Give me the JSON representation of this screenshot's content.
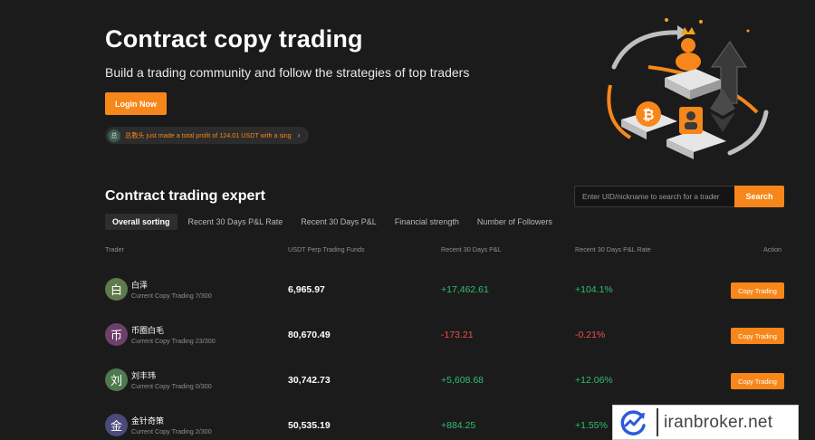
{
  "hero": {
    "title": "Contract copy trading",
    "subtitle": "Build a trading community and follow the strategies of top traders",
    "login_label": "Login Now",
    "notice": {
      "avatar_char": "总",
      "text": "总教头 just made a total profit of 124.01 USDT with a sing"
    }
  },
  "section": {
    "title": "Contract trading expert",
    "search_placeholder": "Enter UID/nickname to search for a trader",
    "search_label": "Search"
  },
  "tabs": [
    {
      "label": "Overall sorting",
      "active": true
    },
    {
      "label": "Recent 30 Days P&L Rate",
      "active": false
    },
    {
      "label": "Recent 30 Days P&L",
      "active": false
    },
    {
      "label": "Financial strength",
      "active": false
    },
    {
      "label": "Number of Followers",
      "active": false
    }
  ],
  "table": {
    "headers": {
      "trader": "Trader",
      "funds": "USDT Perp Trading Funds",
      "pnl": "Recent 30 Days P&L",
      "rate": "Recent 30 Days P&L Rate",
      "action": "Action"
    },
    "rows": [
      {
        "avatar": "白",
        "avatar_color": "#5f7a4e",
        "name": "白泽",
        "copy_count": "Current Copy Trading 7/300",
        "funds": "6,965.97",
        "pnl": "+17,462.61",
        "rate": "+104.1%",
        "trend": "positive",
        "action": "Copy Trading"
      },
      {
        "avatar": "币",
        "avatar_color": "#6d3f6a",
        "name": "币圈白毛",
        "copy_count": "Current Copy Trading 23/300",
        "funds": "80,670.49",
        "pnl": "-173.21",
        "rate": "-0.21%",
        "trend": "negative",
        "action": "Copy Trading"
      },
      {
        "avatar": "刘",
        "avatar_color": "#4f7a4e",
        "name": "刘丰玮",
        "copy_count": "Current Copy Trading 0/300",
        "funds": "30,742.73",
        "pnl": "+5,608.68",
        "rate": "+12.06%",
        "trend": "positive",
        "action": "Copy Trading"
      },
      {
        "avatar": "金",
        "avatar_color": "#4c4a7a",
        "name": "金针奇策",
        "copy_count": "Current Copy Trading 2/300",
        "funds": "50,535.19",
        "pnl": "+884.25",
        "rate": "+1.55%",
        "trend": "positive",
        "action": "Copy Trading"
      }
    ]
  },
  "watermark": {
    "text": "iranbroker.net",
    "icon": "chart-check-logo-icon"
  },
  "colors": {
    "accent": "#f7871a",
    "positive": "#2fbf71",
    "negative": "#ef4f4f",
    "background": "#1b1b1b"
  }
}
